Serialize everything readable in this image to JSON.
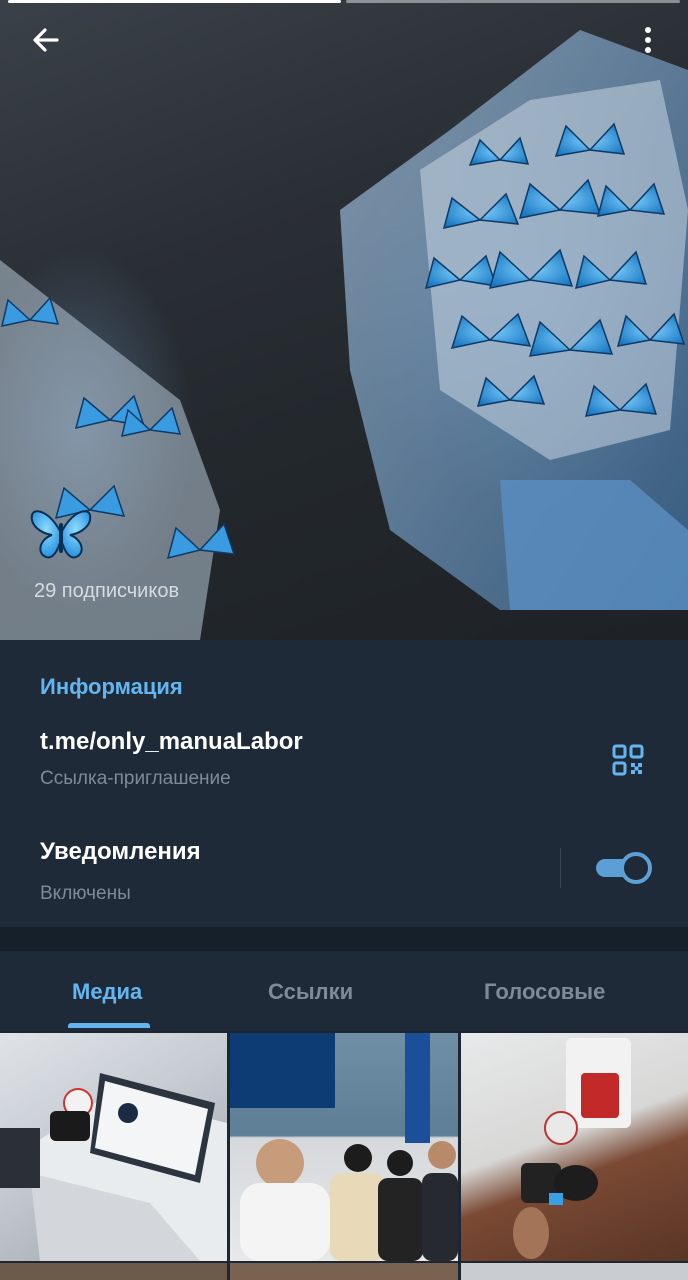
{
  "header": {
    "subscribers": "29 подписчиков",
    "avatar_icon": "butterfly-emoji",
    "back_icon": "arrow-left-icon",
    "menu_icon": "more-vertical-icon"
  },
  "info": {
    "section_title": "Информация",
    "link": "t.me/only_manuaLabor",
    "link_caption": "Ссылка-приглашение",
    "qr_icon": "qr-code-icon",
    "notifications_label": "Уведомления",
    "notifications_status": "Включены",
    "notifications_enabled": true
  },
  "tabs": [
    {
      "label": "Медиа",
      "active": true
    },
    {
      "label": "Ссылки",
      "active": false
    },
    {
      "label": "Голосовые",
      "active": false
    }
  ],
  "colors": {
    "accent": "#64b5ef",
    "panel": "#1f2a38",
    "secondary_text": "#7d8b99",
    "toggle": "#5b9fd6"
  }
}
